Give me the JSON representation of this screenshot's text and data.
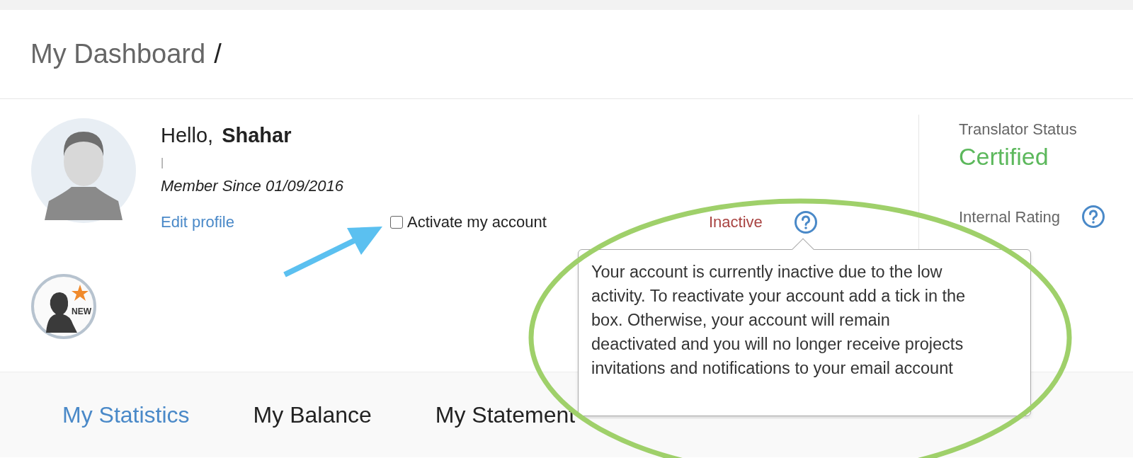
{
  "header": {
    "title": "My Dashboard",
    "separator": "/"
  },
  "profile": {
    "greeting": "Hello,",
    "name": "Shahar",
    "divider": "|",
    "member_since": "Member Since 01/09/2016",
    "edit_link": "Edit profile",
    "badge": "NEW"
  },
  "activation": {
    "label": "Activate my account",
    "checked": false,
    "status": "Inactive",
    "tooltip": "Your account is currently inactive due to the low activity. To reactivate your account add a tick in the box. Otherwise, your account will remain deactivated and you will no longer receive projects invitations and notifications to your email account"
  },
  "side": {
    "status_label": "Translator Status",
    "status_value": "Certified",
    "rating_label": "Internal Rating"
  },
  "tabs": [
    {
      "label": "My Statistics",
      "selected": true
    },
    {
      "label": "My Balance",
      "selected": false
    },
    {
      "label": "My Statement",
      "selected": false
    }
  ]
}
